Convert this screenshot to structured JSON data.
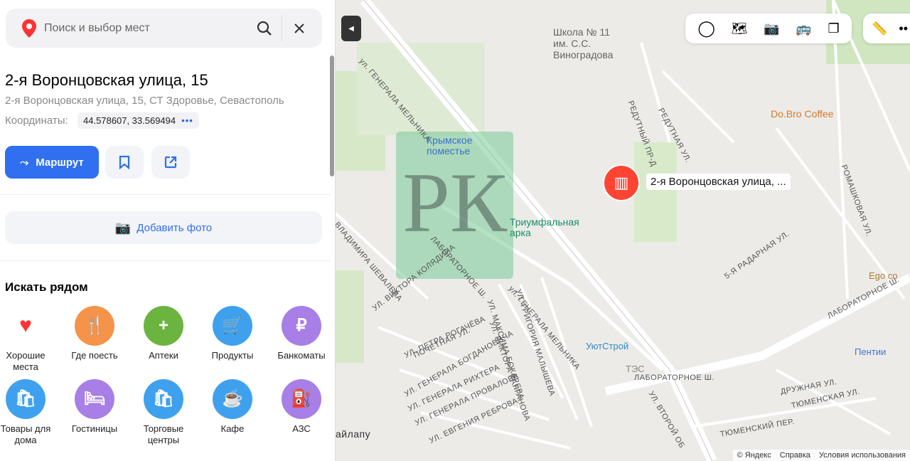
{
  "search": {
    "placeholder": "Поиск и выбор мест"
  },
  "place": {
    "title": "2-я Воронцовская улица, 15",
    "address": "2-я Воронцовская улица, 15, СТ Здоровье, Севастополь",
    "coords_label": "Координаты:",
    "coords": "44.578607, 33.569494",
    "more": "•••"
  },
  "actions": {
    "route": "Маршрут",
    "add_photo": "Добавить фото"
  },
  "nearby": {
    "title": "Искать рядом",
    "items": [
      {
        "label": "Хорошие места",
        "color": "#ffffff"
      },
      {
        "label": "Где поесть",
        "color": "#f5934a"
      },
      {
        "label": "Аптеки",
        "color": "#6bb43f"
      },
      {
        "label": "Продукты",
        "color": "#3fa1ee"
      },
      {
        "label": "Банкоматы",
        "color": "#a77fe6"
      },
      {
        "label": "Товары для дома",
        "color": "#3fa1ee"
      },
      {
        "label": "Гостиницы",
        "color": "#a77fe6"
      },
      {
        "label": "Торговые центры",
        "color": "#3fa1ee"
      },
      {
        "label": "Кафе",
        "color": "#3fa1ee"
      },
      {
        "label": "АЗС",
        "color": "#a77fe6"
      }
    ]
  },
  "map": {
    "pin_label": "2-я Воронцовская улица, ...",
    "pois": [
      {
        "label": "Школа № 11\nим. С.С.\nВиноградова"
      },
      {
        "label": "Крымское\nпоместье"
      },
      {
        "label": "Триумфальная\nарка"
      },
      {
        "label": "Do.Bro Coffee"
      },
      {
        "label": "УютСтрой"
      },
      {
        "label": "ТЭС"
      },
      {
        "label": "Пентии"
      },
      {
        "label": "Ego co"
      }
    ],
    "streets": [
      "ул. ГЕНЕРАЛА МЕЛЬНИКА",
      "ул. ГЕНЕРАЛА МЕЛЬНИКА",
      "ЛАБОРАТОРНОЕ Ш.",
      "ЛАБОРАТОРНОЕ Ш.",
      "ЛАБОРАТОРНОЕ Ш.",
      "РЕДУТНЫЙ ПР-Д",
      "РЕДУТНАЯ УЛ.",
      "5-Я РАДАРНАЯ УЛ.",
      "ВЛАДИМИРА ШЕВАЛЕВА",
      "УЛ. ВИКТОРА КОЛЯДИНА",
      "УЛ. ПЕТРА РОГАЧЁВА",
      "УЛ. ВИКТОРА КАЛГАНОВА",
      "УЛ. МАКСИМА БОКАРЕВА",
      "УЛ. ГРИГОРИЯ МАЛЫШЕВА",
      "ПОЧЕТНАЯ УЛ.",
      "УЛ. ГЕНЕРАЛА БОГДАНОВИЧА",
      "УЛ. ГЕНЕРАЛА РИХТЕРА",
      "УЛ. ГЕНЕРАЛА ПРОВАЛОВА",
      "УЛ. ЕВГЕНИЯ РЕБРОВА",
      "ДРУЖНАЯ УЛ.",
      "ТЮМЕНСКАЯ УЛ.",
      "ТЮМЕНСКИЙ ПЕР.",
      "УЛ. ВТОРОЙ ОБ",
      "РОМАШКОВАЯ УЛ.",
      "айлапу"
    ],
    "footer": {
      "copyright": "© Яндекс",
      "help": "Справка",
      "terms": "Условия использования"
    }
  }
}
